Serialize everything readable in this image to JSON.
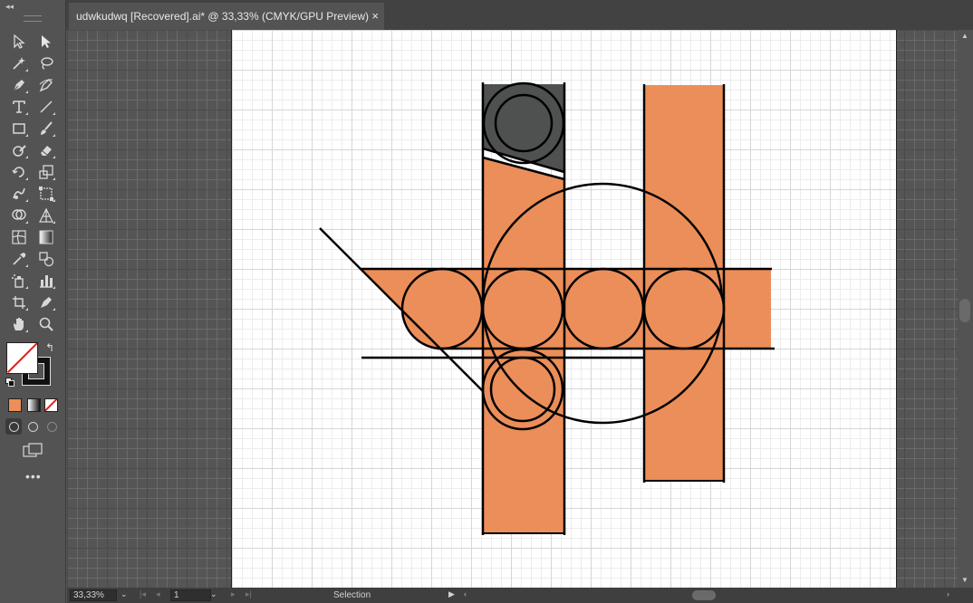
{
  "document": {
    "tab_title": "udwkudwq [Recovered].ai* @ 33,33% (CMYK/GPU Preview)",
    "close_symbol": "×"
  },
  "toolbar": {
    "collapse_symbol": "◂◂",
    "more_symbol": "•••",
    "swap_symbol": "↰",
    "fill_color": "#FFFFFF",
    "stroke_color": "#000000",
    "tools": [
      {
        "name": "selection-tool-icon"
      },
      {
        "name": "direct-selection-tool-icon"
      },
      {
        "name": "magic-wand-tool-icon"
      },
      {
        "name": "lasso-tool-icon"
      },
      {
        "name": "pen-tool-icon"
      },
      {
        "name": "curvature-tool-icon"
      },
      {
        "name": "type-tool-icon"
      },
      {
        "name": "line-segment-tool-icon"
      },
      {
        "name": "rectangle-tool-icon"
      },
      {
        "name": "paintbrush-tool-icon"
      },
      {
        "name": "shaper-tool-icon"
      },
      {
        "name": "eraser-tool-icon"
      },
      {
        "name": "rotate-tool-icon"
      },
      {
        "name": "scale-tool-icon"
      },
      {
        "name": "warp-tool-icon"
      },
      {
        "name": "free-transform-tool-icon"
      },
      {
        "name": "shape-builder-tool-icon"
      },
      {
        "name": "perspective-grid-tool-icon"
      },
      {
        "name": "mesh-tool-icon"
      },
      {
        "name": "gradient-tool-icon"
      },
      {
        "name": "eyedropper-tool-icon"
      },
      {
        "name": "blend-tool-icon"
      },
      {
        "name": "symbol-sprayer-tool-icon"
      },
      {
        "name": "column-graph-tool-icon"
      },
      {
        "name": "artboard-tool-icon"
      },
      {
        "name": "slice-tool-icon"
      },
      {
        "name": "hand-tool-icon"
      },
      {
        "name": "zoom-tool-icon"
      }
    ]
  },
  "artwork": {
    "orange": "#EB8E59",
    "dark_gray": "#4E5150",
    "stroke": "#000000"
  },
  "statusbar": {
    "zoom": "33,33%",
    "artboard_number": "1",
    "status_text": "Selection",
    "dropdown_symbol": "⌄",
    "nav_first": "|◂",
    "nav_prev": "◂",
    "nav_next": "▸",
    "nav_last": "▸|",
    "play_symbol": "▶",
    "scroll_left": "‹",
    "scroll_right": "›"
  },
  "scrollbar": {
    "up_symbol": "▲",
    "down_symbol": "▼"
  }
}
